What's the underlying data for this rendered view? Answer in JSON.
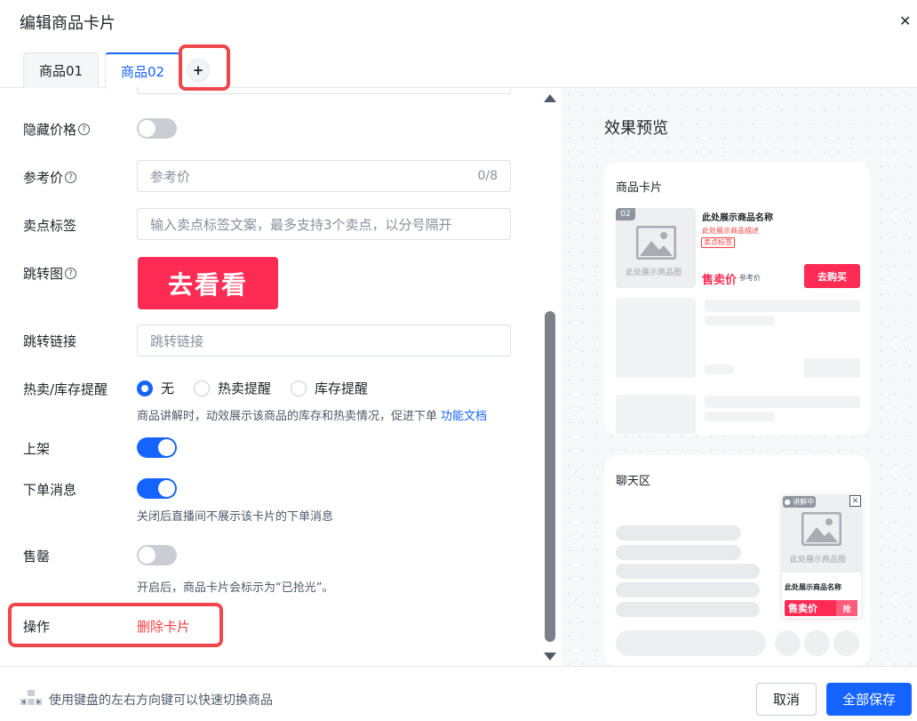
{
  "dialog": {
    "title": "编辑商品卡片",
    "close_icon": "close-icon"
  },
  "tabs": [
    {
      "label": "商品01",
      "active": false
    },
    {
      "label": "商品02",
      "active": true
    }
  ],
  "tab_add_label": "+",
  "form": {
    "hide_price": {
      "label": "隐藏价格",
      "enabled": false
    },
    "reference_price": {
      "label": "参考价",
      "placeholder": "参考价",
      "counter": "0/8"
    },
    "selling_tags": {
      "label": "卖点标签",
      "placeholder": "输入卖点标签文案，最多支持3个卖点，以分号隔开"
    },
    "jump_image": {
      "label": "跳转图",
      "button_text": "去看看"
    },
    "jump_link": {
      "label": "跳转链接",
      "placeholder": "跳转链接"
    },
    "hot_stock": {
      "label": "热卖/库存提醒",
      "options": [
        "无",
        "热卖提醒",
        "库存提醒"
      ],
      "selected": "无",
      "hint": "商品讲解时，动效展示该商品的库存和热卖情况，促进下单",
      "doc_link": "功能文档"
    },
    "listed": {
      "label": "上架",
      "enabled": true
    },
    "order_message": {
      "label": "下单消息",
      "enabled": true,
      "hint": "关闭后直播间不展示该卡片的下单消息"
    },
    "sold_out": {
      "label": "售罄",
      "enabled": false,
      "hint": "开启后，商品卡片会标示为“已抢光”。"
    },
    "operation": {
      "label": "操作",
      "delete_label": "删除卡片"
    }
  },
  "preview": {
    "title": "效果预览",
    "product_card": {
      "title": "商品卡片",
      "badge": "02",
      "image_placeholder": "此处展示商品图",
      "name": "此处展示商品名称",
      "description": "此处展示商品描述",
      "tag": "卖点标签",
      "price_label": "售卖价",
      "reference_label": "参考价",
      "buy_button": "去购买"
    },
    "chat_area": {
      "title": "聊天区",
      "float_badge": "● 讲解中",
      "image_placeholder": "此处展示商品图",
      "name": "此处展示商品名称",
      "price_label": "售卖价",
      "grab_label": "抢"
    }
  },
  "footer": {
    "tip": "使用键盘的左右方向键可以快速切换商品",
    "cancel_label": "取消",
    "save_label": "全部保存"
  },
  "colors": {
    "accent": "#1664ff",
    "brand_red": "#fe2c55",
    "danger": "#f53f3f",
    "highlight": "#f0454a"
  }
}
